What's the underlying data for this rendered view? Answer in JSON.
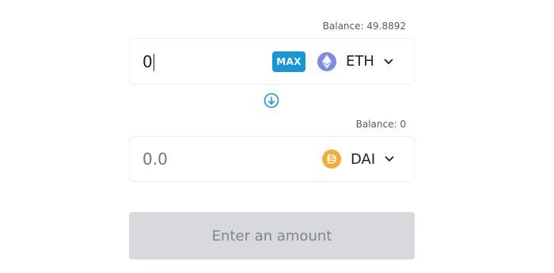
{
  "from": {
    "balance_label": "Balance: 49.8892",
    "amount": "0",
    "max_label": "MAX",
    "token": {
      "symbol": "ETH",
      "icon": "ethereum-icon",
      "color": "#7b89e9"
    }
  },
  "to": {
    "balance_label": "Balance: 0",
    "amount_placeholder": "0.0",
    "token": {
      "symbol": "DAI",
      "icon": "dai-icon",
      "color": "#f5ac37"
    }
  },
  "swap_icon": "arrow-down-circle-icon",
  "accent_color": "#1597d8",
  "submit_label": "Enter an amount"
}
